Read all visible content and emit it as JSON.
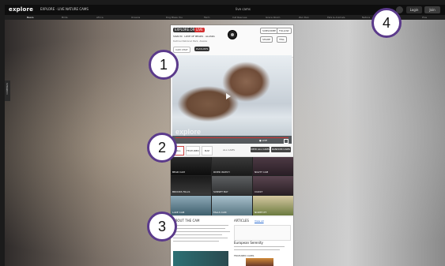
{
  "app": {
    "logo": "explore",
    "tagline": "EXPLORE · LIVE NATURE CAMS",
    "window_title": "live cams"
  },
  "topbar": {
    "buttons": [
      "Login",
      "Join"
    ]
  },
  "nav": {
    "items": [
      "Bears",
      "Birds",
      "Africa",
      "Oceans",
      "Dog Bless You",
      "Farm",
      "Cat Rescues",
      "Grace Room",
      "Zen Den",
      "Pets & Animals",
      "Nature",
      "Music",
      "Plus"
    ]
  },
  "sidebar": {
    "tab_label": "CAMERAS"
  },
  "video_header": {
    "tags": [
      "EXPLORE.ORG",
      "LIVE"
    ],
    "title": "SIGN IN · LOVE OF BEARS · ALASKA",
    "subtitle": "Katmai National Park, Alaska",
    "right_buttons": [
      "SUBSCRIBE",
      "FOLLOW",
      "SHARE",
      "TELL"
    ],
    "small_buttons": [
      "CAM CHAT",
      "PLAYLISTS"
    ]
  },
  "video": {
    "brand": "explore",
    "status": "● LIVE"
  },
  "tabs": {
    "items": [
      "ALL CAMS",
      "FEATURED",
      "MAP"
    ],
    "center_text": "ALL CAMS",
    "right_buttons": [
      "VIEW ALL CAMS",
      "RANDOM CAMS"
    ]
  },
  "thumbnails": [
    {
      "label": "BEAR CAM"
    },
    {
      "label": "RIVER WATCH"
    },
    {
      "label": "NIGHT CAM"
    },
    {
      "label": "BROOKS FALLS"
    },
    {
      "label": "SUNSET BAY"
    },
    {
      "label": "COAST"
    },
    {
      "label": "LAKE CAM"
    },
    {
      "label": "FALLS CAM"
    },
    {
      "label": "NORTH PT"
    }
  ],
  "panels": {
    "left_title": "ABOUT THE CAM",
    "right_title": "ARTICLES",
    "right_link": "View all",
    "right_subtitle": "European Serenity",
    "bottom_title": "FEATURED CAMS"
  },
  "colors": {
    "accent": "#d32f2f",
    "callout_border": "#5b3a8b",
    "topbar": "#0e0e0e"
  },
  "callouts": [
    "1",
    "2",
    "3",
    "4"
  ]
}
